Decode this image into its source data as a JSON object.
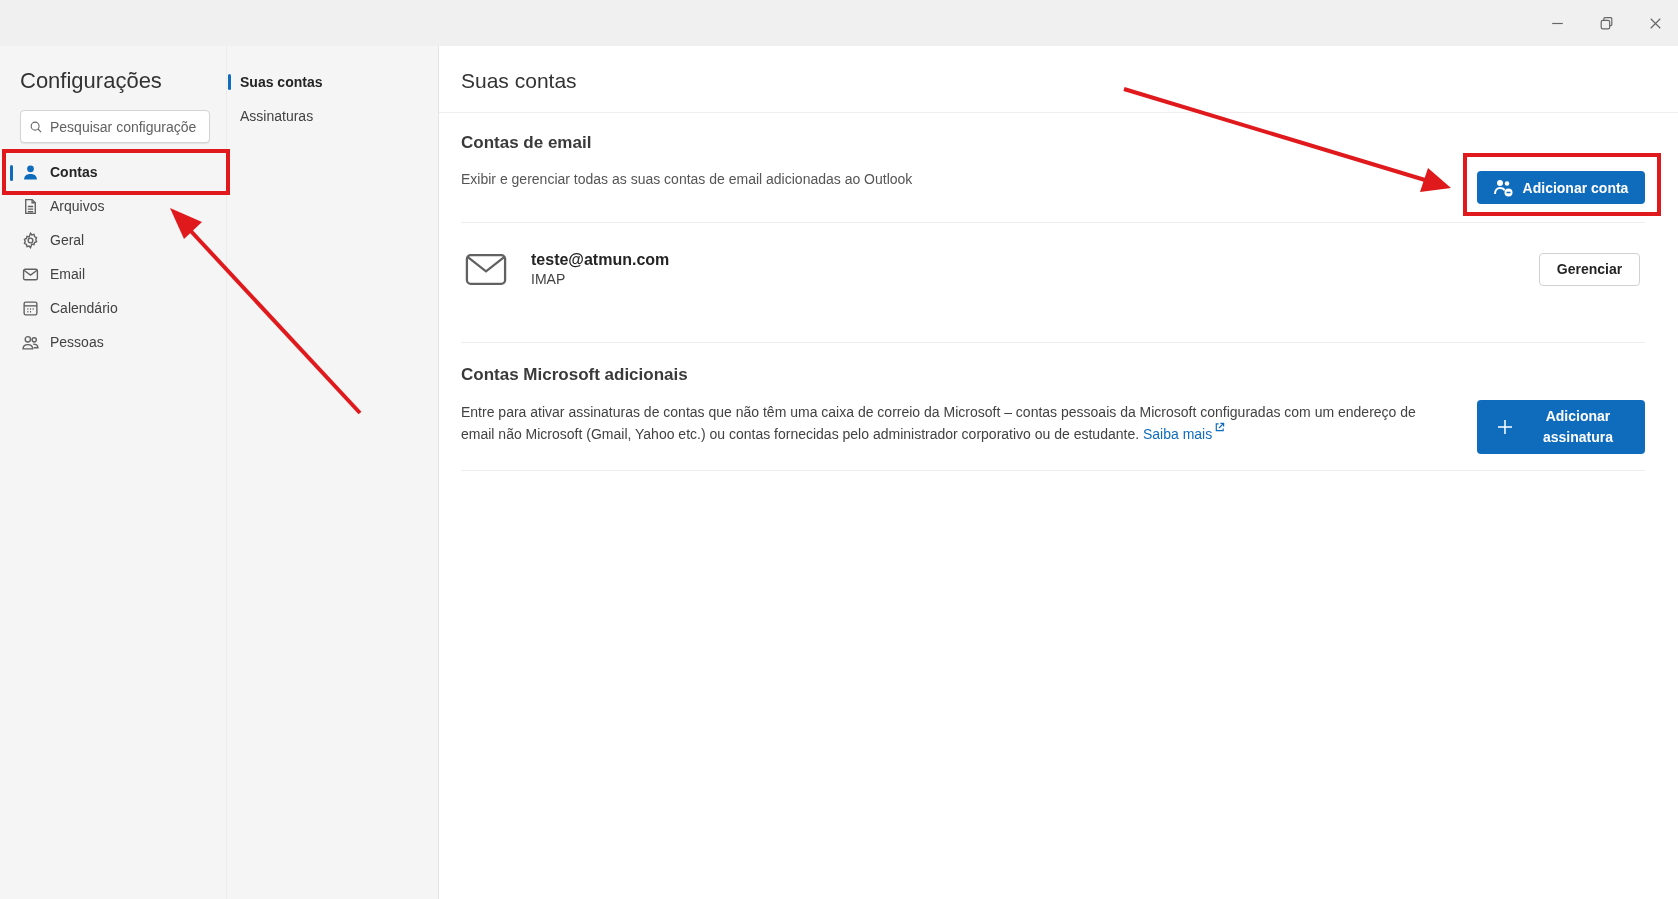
{
  "sidebar": {
    "title": "Configurações",
    "search": {
      "placeholder": "Pesquisar configuraçõe"
    },
    "items": [
      {
        "label": "Contas",
        "selected": true
      },
      {
        "label": "Arquivos",
        "selected": false
      },
      {
        "label": "Geral",
        "selected": false
      },
      {
        "label": "Email",
        "selected": false
      },
      {
        "label": "Calendário",
        "selected": false
      },
      {
        "label": "Pessoas",
        "selected": false
      }
    ]
  },
  "subnav": {
    "items": [
      {
        "label": "Suas contas",
        "selected": true
      },
      {
        "label": "Assinaturas",
        "selected": false
      }
    ]
  },
  "main": {
    "title": "Suas contas",
    "email_section": {
      "heading": "Contas de email",
      "description": "Exibir e gerenciar todas as suas contas de email adicionadas ao Outlook",
      "button": "Adicionar conta",
      "accounts": [
        {
          "address": "teste@atmun.com",
          "type": "IMAP",
          "button": "Gerenciar"
        }
      ]
    },
    "microsoft_section": {
      "heading": "Contas Microsoft adicionais",
      "description": "Entre para ativar assinaturas de contas que não têm uma caixa de correio da Microsoft – contas pessoais da Microsoft configuradas com um endereço de email não Microsoft (Gmail, Yahoo etc.) ou contas fornecidas pelo administrador corporativo ou de estudante.",
      "link": "Saiba mais",
      "button": "Adicionar assinatura"
    }
  }
}
